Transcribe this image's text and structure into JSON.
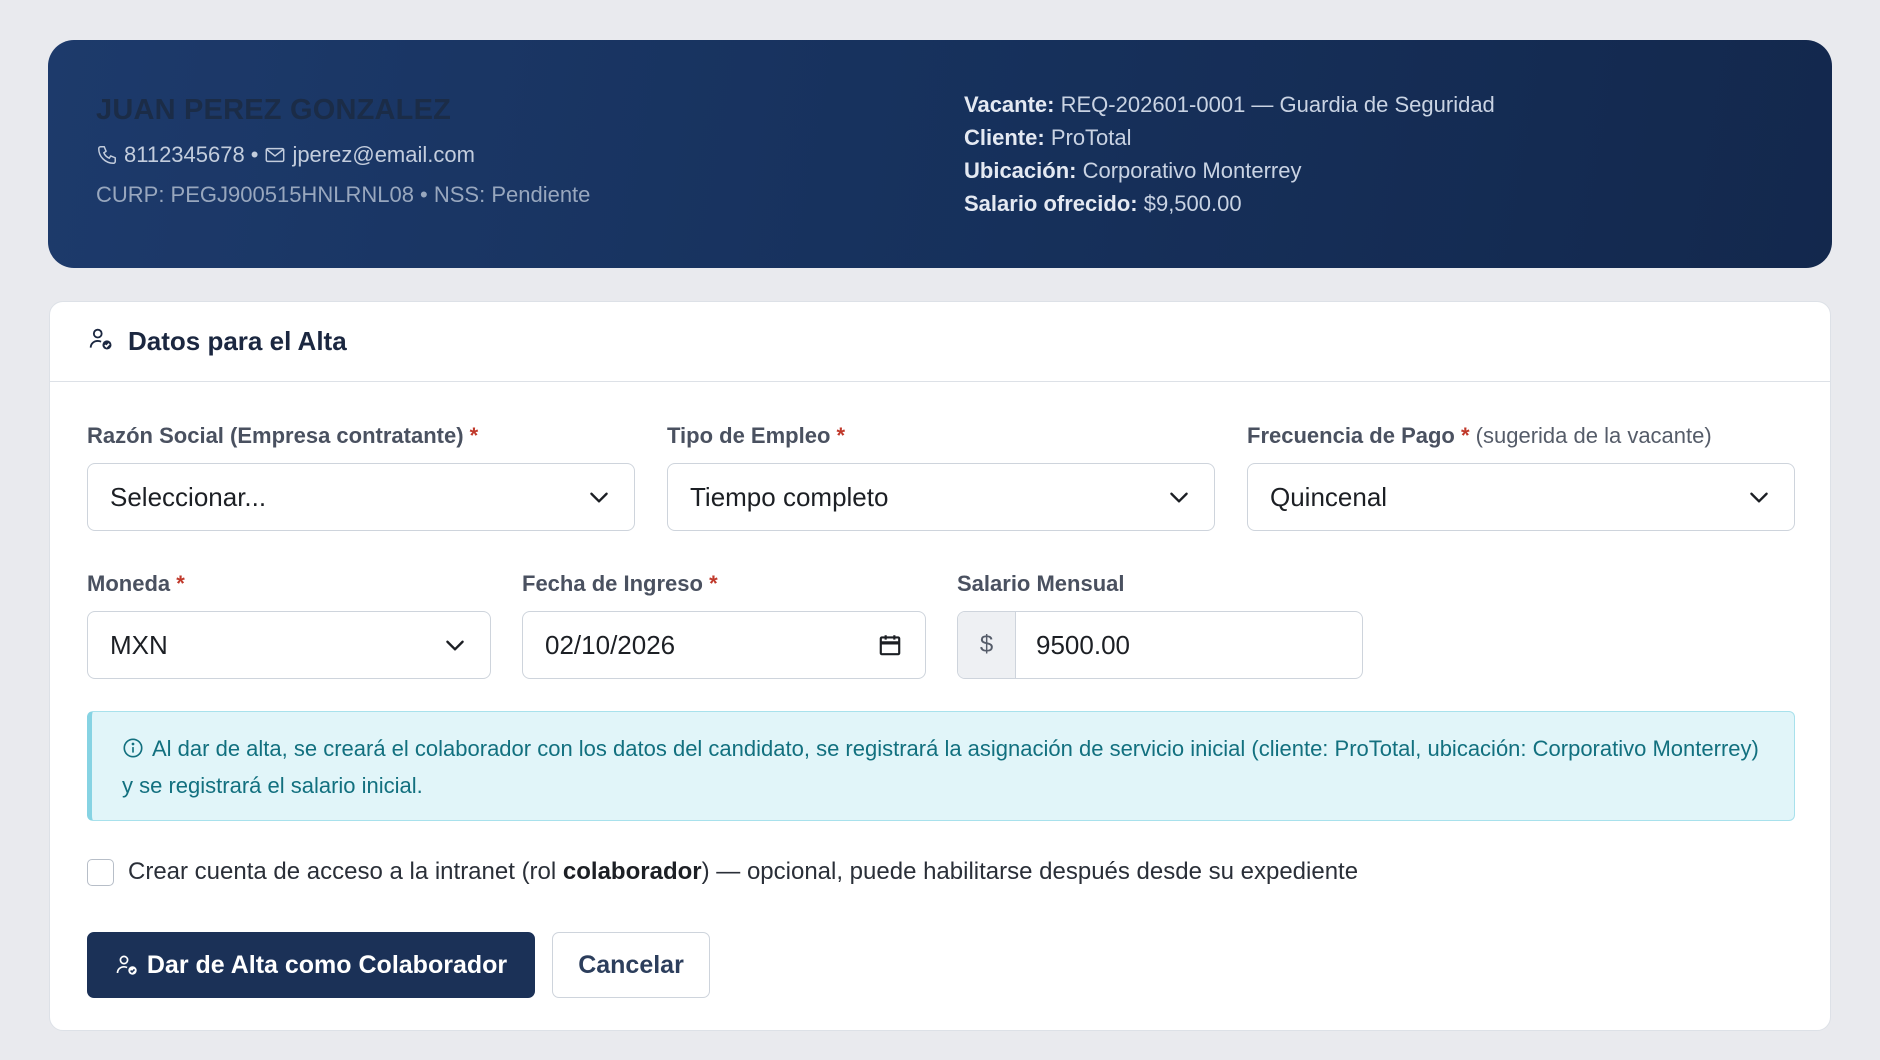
{
  "candidate": {
    "name": "JUAN PEREZ GONZALEZ",
    "phone": "8112345678",
    "separator": "•",
    "email": "jperez@email.com",
    "ids": "CURP: PEGJ900515HNLRNL08 • NSS: Pendiente"
  },
  "vacancy": {
    "vacante_label": "Vacante:",
    "vacante_value": "REQ-202601-0001 — Guardia de Seguridad",
    "cliente_label": "Cliente:",
    "cliente_value": "ProTotal",
    "ubicacion_label": "Ubicación:",
    "ubicacion_value": "Corporativo Monterrey",
    "salario_label": "Salario ofrecido:",
    "salario_value": "$9,500.00"
  },
  "form": {
    "title": "Datos para el Alta",
    "required_mark": "*",
    "razon_social": {
      "label": "Razón Social (Empresa contratante)",
      "value": "Seleccionar..."
    },
    "tipo_empleo": {
      "label": "Tipo de Empleo",
      "value": "Tiempo completo"
    },
    "frecuencia_pago": {
      "label": "Frecuencia de Pago",
      "hint": "(sugerida de la vacante)",
      "value": "Quincenal"
    },
    "moneda": {
      "label": "Moneda",
      "value": "MXN"
    },
    "fecha_ingreso": {
      "label": "Fecha de Ingreso",
      "value": "02/10/2026"
    },
    "salario_mensual": {
      "label": "Salario Mensual",
      "prefix": "$",
      "value": "9500.00"
    },
    "info_text": "Al dar de alta, se creará el colaborador con los datos del candidato, se registrará la asignación de servicio inicial (cliente: ProTotal, ubicación: Corporativo Monterrey) y se registrará el salario inicial.",
    "checkbox": {
      "text_before": "Crear cuenta de acceso a la intranet (rol ",
      "role": "colaborador",
      "text_after": ") — opcional, puede habilitarse después desde su expediente",
      "checked": false
    },
    "submit_label": "Dar de Alta como Colaborador",
    "cancel_label": "Cancelar"
  },
  "colors": {
    "banner": "#17325e",
    "primary": "#1b3157",
    "info_bg": "#e1f5f9",
    "info_text": "#12707f",
    "required": "#c0392b"
  }
}
